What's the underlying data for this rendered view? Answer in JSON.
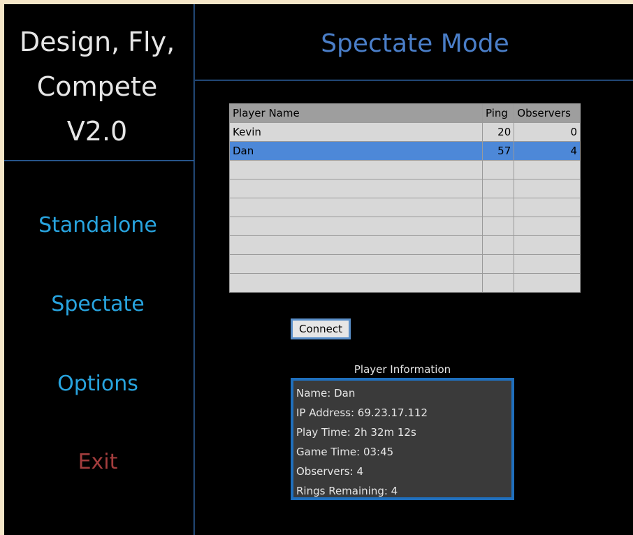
{
  "app": {
    "title_lines": [
      "Design, Fly,",
      "Compete",
      "V2.0"
    ]
  },
  "nav": {
    "items": [
      {
        "label": "Standalone"
      },
      {
        "label": "Spectate"
      },
      {
        "label": "Options"
      },
      {
        "label": "Exit"
      }
    ]
  },
  "page": {
    "title": "Spectate Mode"
  },
  "table": {
    "headers": [
      "Player Name",
      "Ping",
      "Observers"
    ],
    "rows": [
      {
        "name": "Kevin",
        "ping": "20",
        "observers": "0",
        "selected": false
      },
      {
        "name": "Dan",
        "ping": "57",
        "observers": "4",
        "selected": true
      }
    ],
    "empty_rows": 7
  },
  "connect": {
    "label": "Connect"
  },
  "player_info": {
    "heading": "Player Information",
    "lines": [
      "Name: Dan",
      "IP Address: 69.23.17.112",
      "Play Time: 2h 32m 12s",
      "Game Time: 03:45",
      "Observers: 4",
      "Rings Remaining: 4"
    ]
  },
  "colors": {
    "nav_link": "#28a4df",
    "exit_link": "#a33d3d",
    "page_title": "#4a7ec8",
    "selected_row": "#4d88d8",
    "divider": "#2a5d98"
  }
}
